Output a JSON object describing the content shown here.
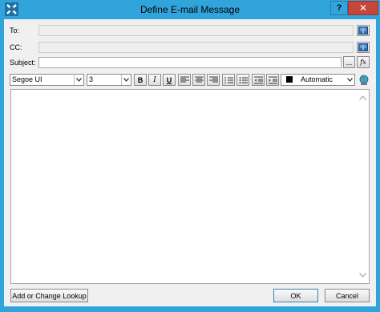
{
  "window": {
    "title": "Define E-mail Message",
    "help_label": "?",
    "close_label": "✕",
    "accent": "#31a5db"
  },
  "fields": {
    "to_label": "To:",
    "cc_label": "CC:",
    "subject_label": "Subject:",
    "subject_value": "",
    "ellipsis_label": "...",
    "function_label": "fx"
  },
  "toolbar": {
    "font_name": "Segoe UI",
    "font_size": "3",
    "bold_label": "B",
    "italic_label": "I",
    "underline_label": "U",
    "color_label": "Automatic"
  },
  "buttons": {
    "lookup_label": "Add or Change Lookup",
    "ok_label": "OK",
    "cancel_label": "Cancel"
  }
}
